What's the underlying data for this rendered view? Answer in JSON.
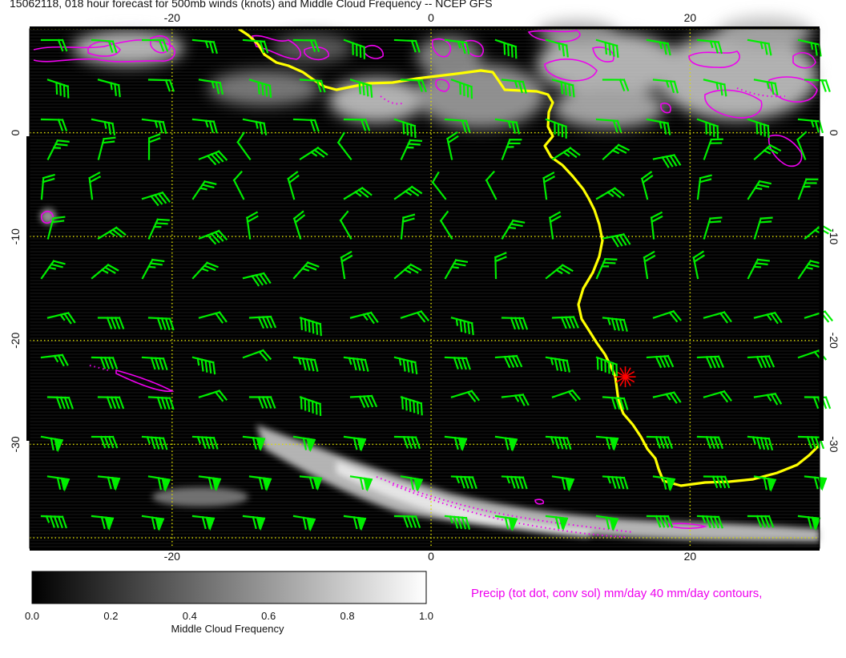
{
  "title": "15062118, 018 hour forecast for 500mb winds (knots) and Middle Cloud Frequency -- NCEP GFS",
  "map": {
    "lon_range": [
      -31,
      30
    ],
    "lat_range": [
      -40,
      10
    ],
    "grid_lons": [
      -20,
      0,
      20
    ],
    "grid_lats": [
      10,
      0,
      -10,
      -20,
      -30,
      -39
    ],
    "top_tick_labels": [
      "-20",
      "0",
      "20"
    ],
    "bottom_tick_labels": [
      "-20",
      "0",
      "20"
    ],
    "left_tick_labels": [
      "0",
      "-10",
      "-20",
      "-30"
    ],
    "right_tick_labels": [
      "0",
      "-10",
      "-20",
      "-30"
    ],
    "marker": {
      "lon": 15,
      "lat": -23.5,
      "symbol": "red-star"
    }
  },
  "colorbar": {
    "label": "Middle Cloud Frequency",
    "ticks": [
      "0.0",
      "0.2",
      "0.4",
      "0.6",
      "0.8",
      "1.0"
    ],
    "range": [
      0.0,
      1.0
    ]
  },
  "precip_caption": "Precip (tot dot, conv sol) mm/day 40 mm/day contours,",
  "colors": {
    "wind_barbs": "#00ee00",
    "coastline": "#ffff00",
    "grid": "#dddd00",
    "precip": "#ee00ee",
    "marker": "#ff0000"
  }
}
